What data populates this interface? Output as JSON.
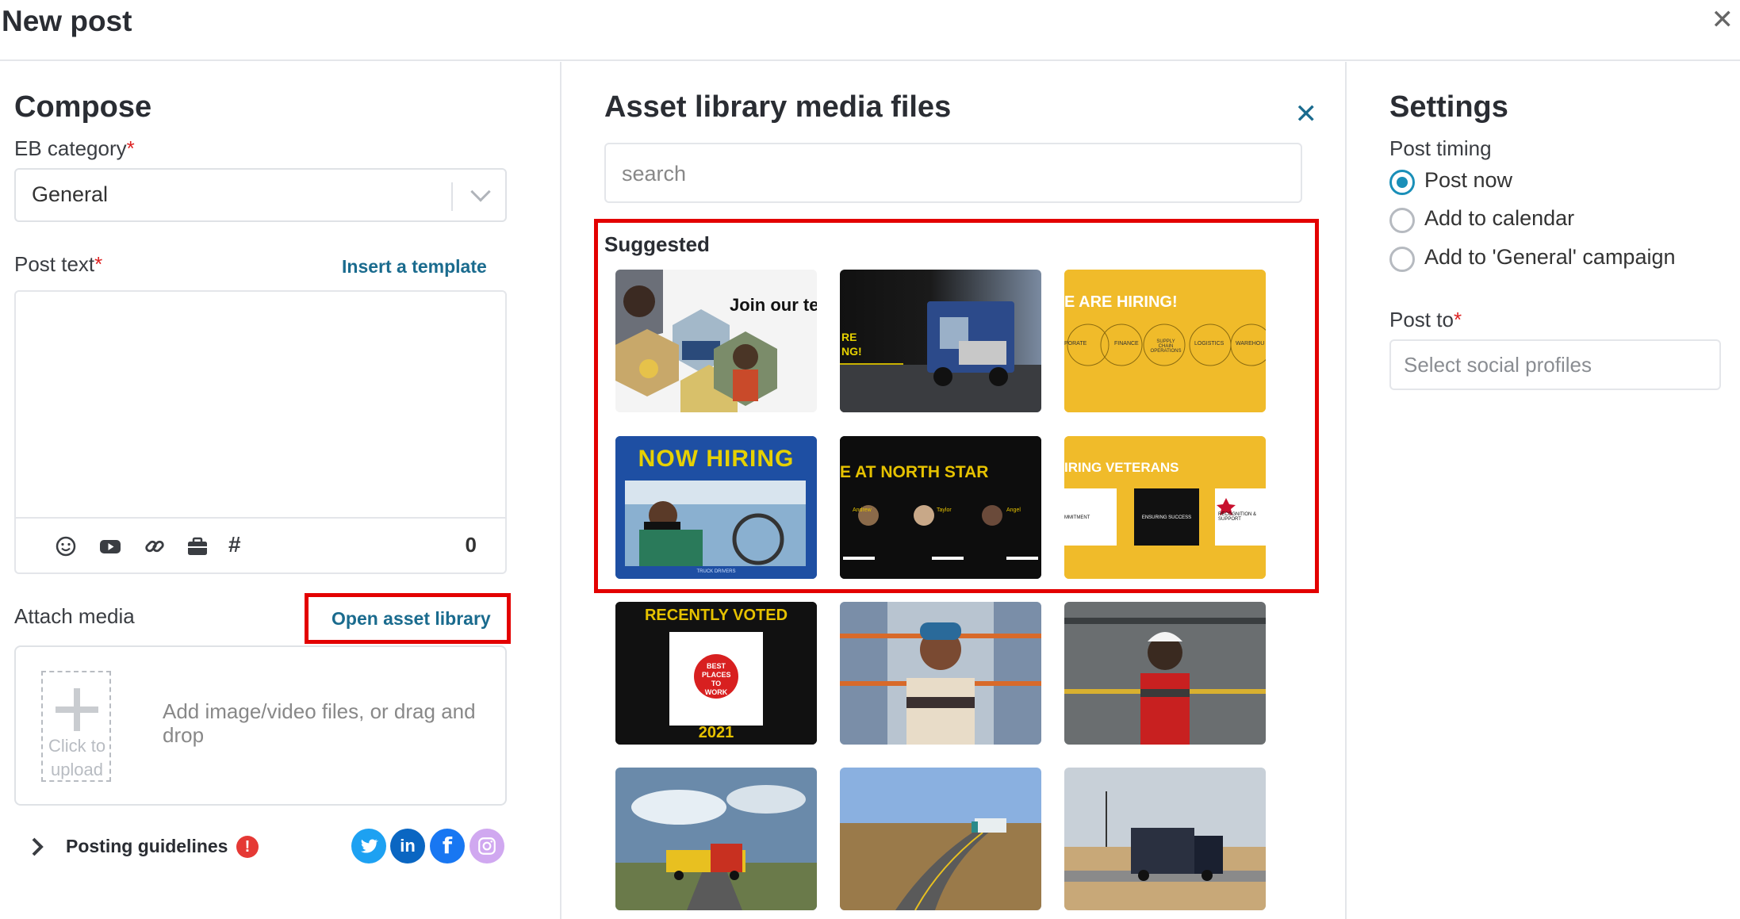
{
  "header": {
    "title": "New post",
    "close_icon": "close-icon"
  },
  "compose": {
    "heading": "Compose",
    "category_label": "EB category",
    "required_mark": "*",
    "category_value": "General",
    "post_text_label": "Post text",
    "insert_template_link": "Insert a template",
    "toolbar_icons": [
      "emoji-icon",
      "youtube-icon",
      "link-icon",
      "briefcase-icon",
      "hashtag-icon"
    ],
    "char_count": "0",
    "attach_media_label": "Attach media",
    "open_asset_library_link": "Open asset library",
    "upload_tile_text": "Click to upload",
    "upload_hint": "Add image/video files, or drag and drop",
    "posting_guidelines": "Posting guidelines",
    "warning_mark": "!",
    "social_networks": [
      "twitter-icon",
      "linkedin-icon",
      "facebook-icon",
      "instagram-icon"
    ]
  },
  "assets": {
    "heading": "Asset library media files",
    "search_placeholder": "search",
    "suggested_label": "Suggested",
    "thumbs": {
      "t1": {
        "text": "Join our tea"
      },
      "t2": {
        "text": "RE NG!"
      },
      "t3": {
        "text": "E ARE HIRING!",
        "sub": [
          "PORATE",
          "FINANCE",
          "SUPPLY CHAIN OPERATIONS",
          "LOGISTICS",
          "WAREHOU"
        ]
      },
      "t4": {
        "text": "NOW HIRING",
        "footer": "TRUCK DRIVERS"
      },
      "t5": {
        "text": "E AT NORTH STAR",
        "names": [
          "Andrew",
          "Taylor",
          "Angel"
        ]
      },
      "t6": {
        "text": "IRING VETERANS",
        "sub": [
          "MMITMENT",
          "ENSURING SUCCESS",
          "RECOGNITION & SUPPORT"
        ]
      },
      "t7": {
        "text": "RECENTLY VOTED",
        "badge": "BEST PLACES TO WORK",
        "year": "2021"
      }
    }
  },
  "settings": {
    "heading": "Settings",
    "post_timing_label": "Post timing",
    "options": [
      "Post now",
      "Add to calendar",
      "Add to 'General' campaign"
    ],
    "selected_option": "Post now",
    "post_to_label": "Post to",
    "profiles_placeholder": "Select social profiles"
  },
  "colors": {
    "accent": "#1a8fb8",
    "link": "#1a6b8e",
    "highlight": "#e30000",
    "required": "#dd2222"
  }
}
